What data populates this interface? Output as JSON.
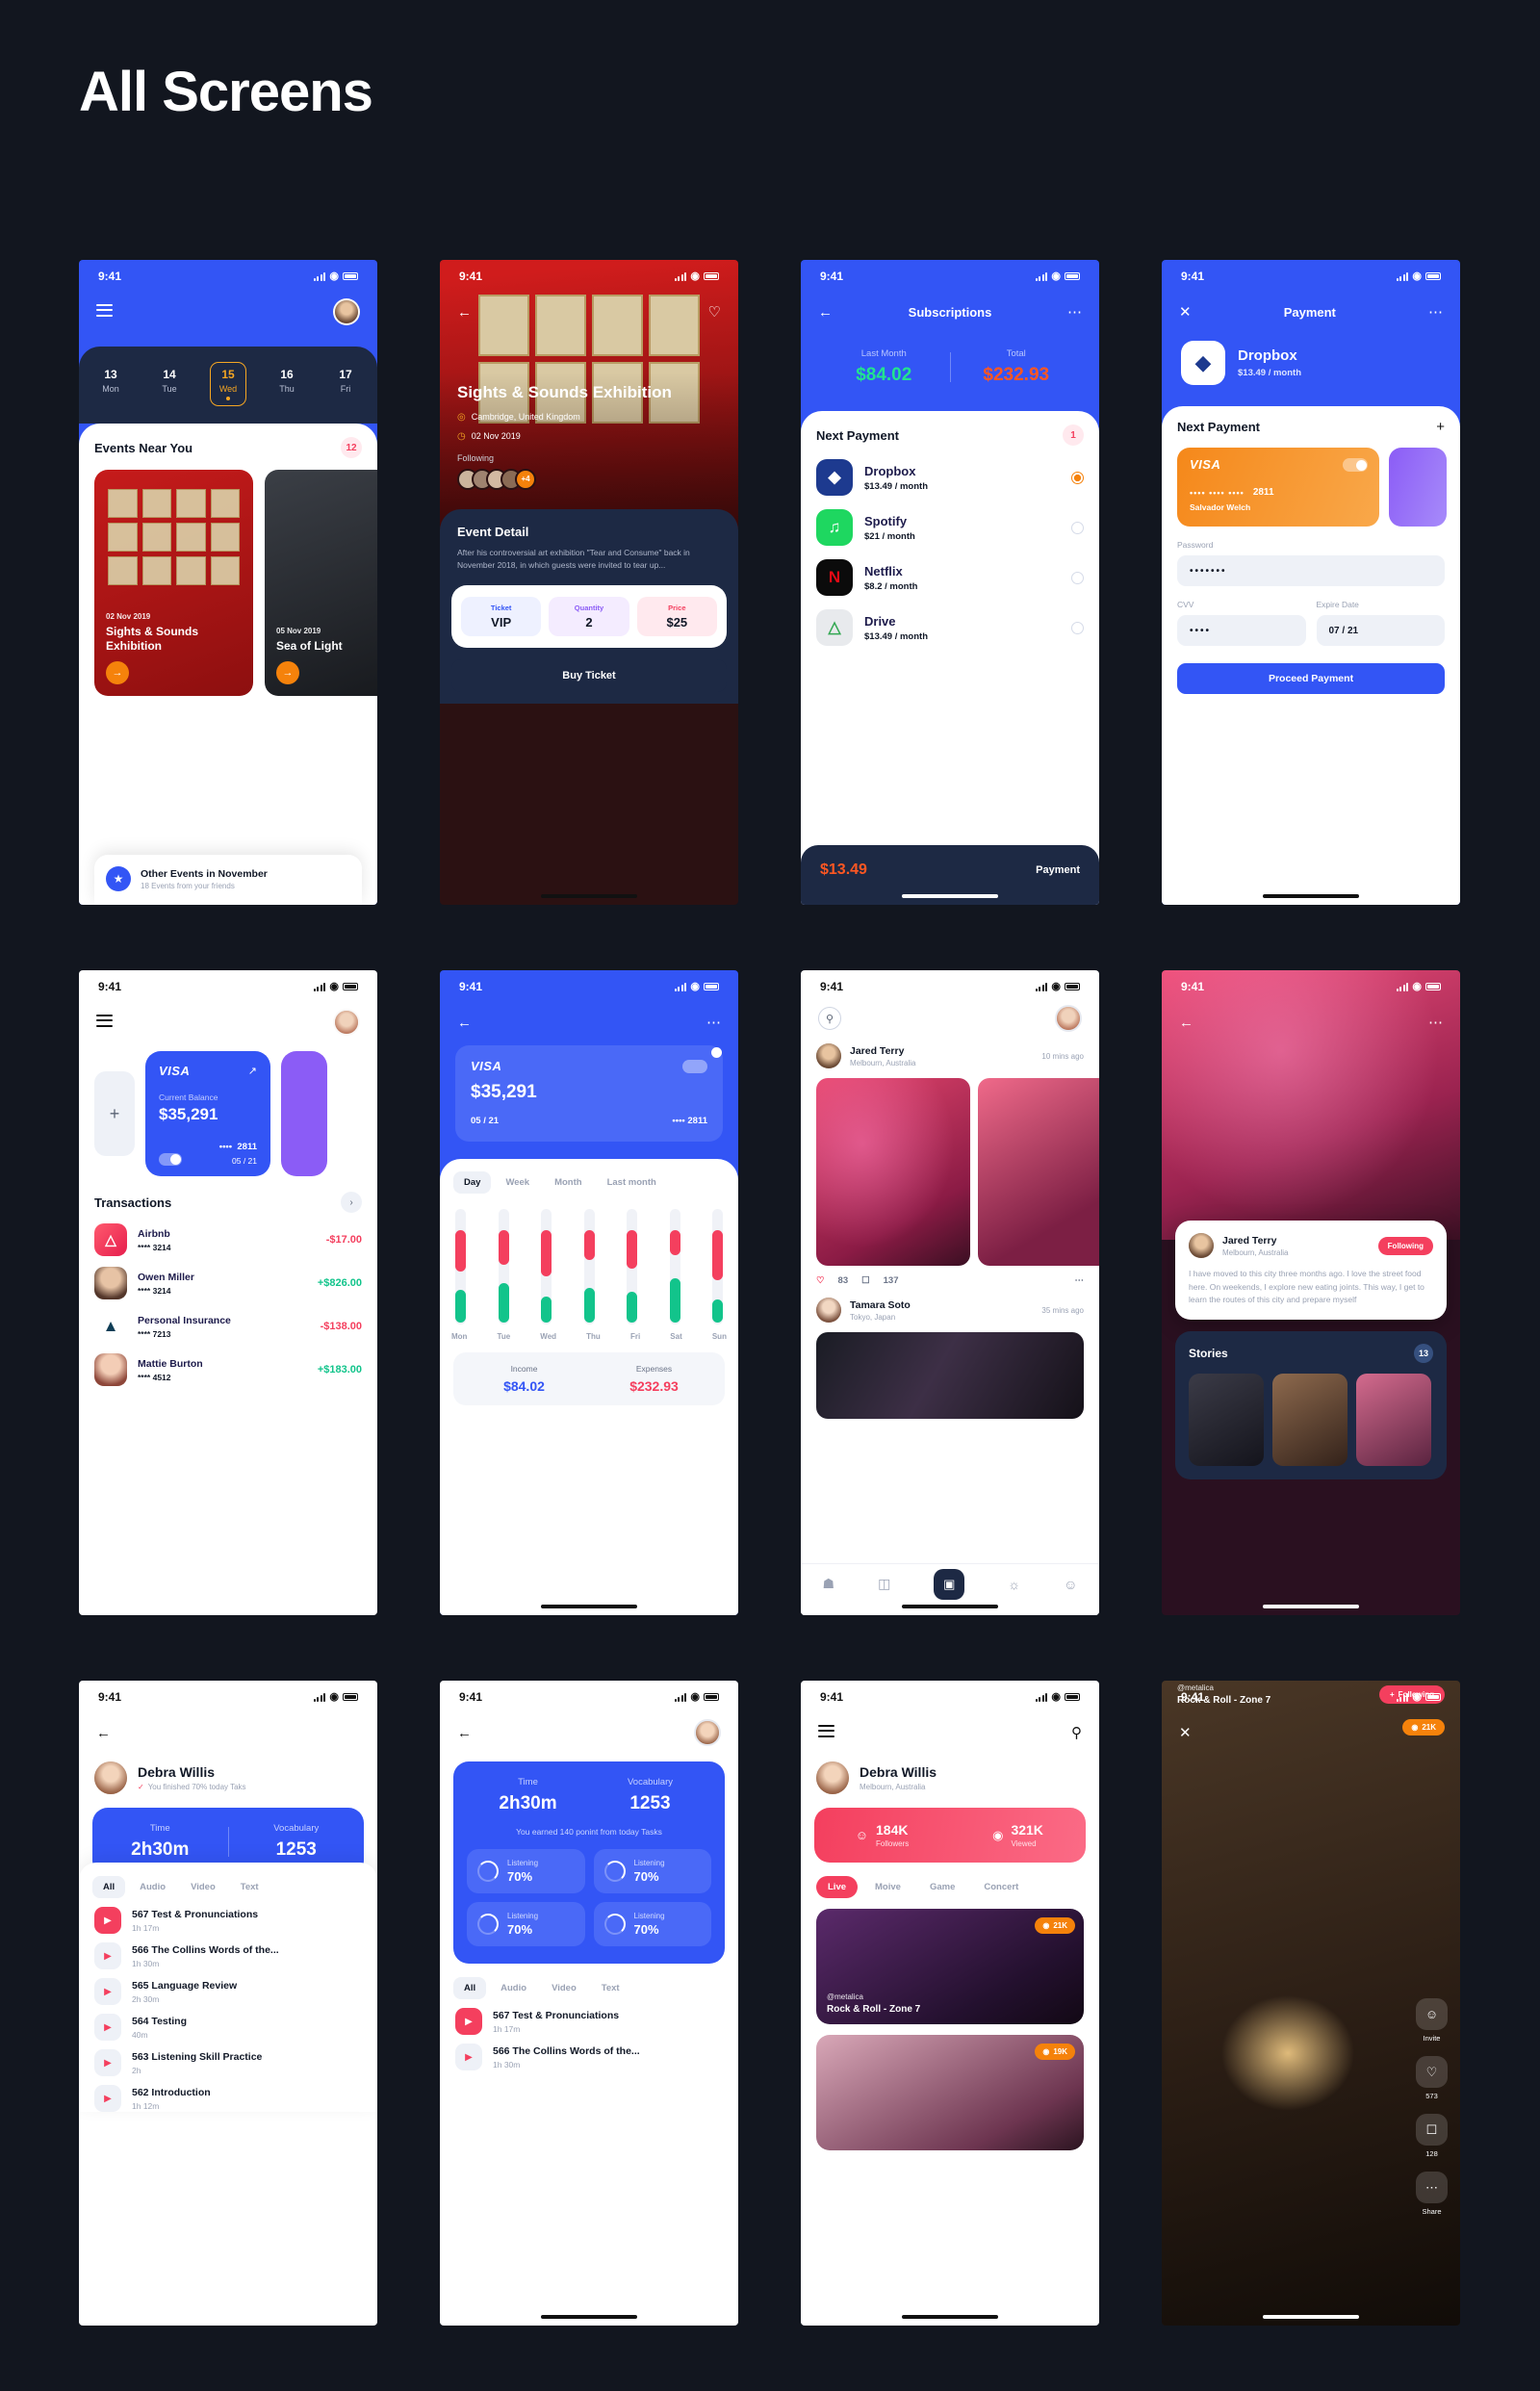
{
  "page": {
    "title": "All Screens"
  },
  "status_bar": {
    "time": "9:41"
  },
  "screens": {
    "events": {
      "calendar": [
        {
          "day": "13",
          "weekday": "Mon"
        },
        {
          "day": "14",
          "weekday": "Tue"
        },
        {
          "day": "15",
          "weekday": "Wed"
        },
        {
          "day": "16",
          "weekday": "Thu"
        },
        {
          "day": "17",
          "weekday": "Fri"
        }
      ],
      "section_title": "Events Near You",
      "badge": "12",
      "cards": [
        {
          "date": "02 Nov 2019",
          "name": "Sights & Sounds Exhibition"
        },
        {
          "date": "05 Nov 2019",
          "name": "Sea of Light"
        }
      ],
      "other": {
        "title": "Other Events in November",
        "subtitle": "18 Events from your friends"
      }
    },
    "event_detail": {
      "title": "Sights & Sounds Exhibition",
      "location": "Cambridge, United Kingdom",
      "date": "02 Nov 2019",
      "following_label": "Following",
      "followers_more": "+4",
      "panel_title": "Event Detail",
      "panel_text": "After his controversial art exhibition \"Tear and Consume\" back in November 2018, in which guests were invited to tear up...",
      "options": [
        {
          "label": "Ticket",
          "value": "VIP"
        },
        {
          "label": "Quantity",
          "value": "2"
        },
        {
          "label": "Price",
          "value": "$25"
        }
      ],
      "buy_button": "Buy Ticket"
    },
    "subscriptions": {
      "title": "Subscriptions",
      "stats": [
        {
          "label": "Last Month",
          "value": "$84.02"
        },
        {
          "label": "Total",
          "value": "$232.93"
        }
      ],
      "next_payment_label": "Next Payment",
      "badge": "1",
      "items": [
        {
          "name": "Dropbox",
          "price": "$13.49 / month",
          "selected": true
        },
        {
          "name": "Spotify",
          "price": "$21 / month",
          "selected": false
        },
        {
          "name": "Netflix",
          "price": "$8.2 / month",
          "selected": false
        },
        {
          "name": "Drive",
          "price": "$13.49 / month",
          "selected": false
        }
      ],
      "footer": {
        "amount": "$13.49",
        "action": "Payment"
      }
    },
    "payment": {
      "title": "Payment",
      "app_name": "Dropbox",
      "app_price": "$13.49 / month",
      "next_payment_label": "Next Payment",
      "card": {
        "brand": "VISA",
        "dots": "••••  ••••  ••••",
        "last4": "2811",
        "holder": "Salvador Welch"
      },
      "fields": {
        "password_label": "Password",
        "password_value": "•••••••",
        "cvv_label": "CVV",
        "cvv_value": "••••",
        "expire_label": "Expire Date",
        "expire_value": "07 / 21"
      },
      "submit": "Proceed Payment"
    },
    "wallet": {
      "card": {
        "brand": "VISA",
        "balance_label": "Current Balance",
        "balance": "$35,291",
        "last4": "2811",
        "expire": "05 / 21"
      },
      "transactions_title": "Transactions",
      "transactions": [
        {
          "name": "Airbnb",
          "card": "**** 3214",
          "amount": "-$17.00",
          "sign": "neg"
        },
        {
          "name": "Owen Miller",
          "card": "**** 3214",
          "amount": "+$826.00",
          "sign": "pos"
        },
        {
          "name": "Personal Insurance",
          "card": "**** 7213",
          "amount": "-$138.00",
          "sign": "neg"
        },
        {
          "name": "Mattie Burton",
          "card": "**** 4512",
          "amount": "+$183.00",
          "sign": "pos"
        }
      ]
    },
    "stats": {
      "card": {
        "brand": "VISA",
        "balance": "$35,291",
        "expire": "05 / 21",
        "dots": "••••",
        "last4": "2811"
      },
      "tabs": [
        "Day",
        "Week",
        "Month",
        "Last month"
      ],
      "active_tab": "Day",
      "summary": [
        {
          "label": "Income",
          "value": "$84.02"
        },
        {
          "label": "Expenses",
          "value": "$232.93"
        }
      ]
    },
    "feed": {
      "posts": [
        {
          "name": "Jared Terry",
          "location": "Melbourn, Australia",
          "time": "10 mins ago",
          "likes": "83",
          "comments": "137"
        },
        {
          "name": "Tamara Soto",
          "location": "Tokyo, Japan",
          "time": "35 mins ago"
        }
      ]
    },
    "profile_story": {
      "name": "Jared Terry",
      "location": "Melbourn, Australia",
      "follow_button": "Following",
      "bio": "I have moved to this city three months ago. I love the street food here. On weekends, I explore new eating joints. This way, I get to learn the routes of this city and prepare myself",
      "stories_title": "Stories",
      "stories_count": "13"
    },
    "profile_lessons": {
      "name": "Debra Willis",
      "subtitle": "You  finished 70% today Taks",
      "stats": [
        {
          "label": "Time",
          "value": "2h30m"
        },
        {
          "label": "Vocabulary",
          "value": "1253"
        }
      ],
      "tabs": [
        "All",
        "Audio",
        "Video",
        "Text"
      ],
      "active_tab": "All",
      "lessons": [
        {
          "name": "567 Test & Pronunciations",
          "duration": "1h 17m",
          "active": true
        },
        {
          "name": "566 The Collins Words of the...",
          "duration": "1h 30m",
          "active": false
        },
        {
          "name": "565 Language Review",
          "duration": "2h 30m",
          "active": false
        },
        {
          "name": "564 Testing",
          "duration": "40m",
          "active": false
        },
        {
          "name": "563 Listening Skill Practice",
          "duration": "2h",
          "active": false
        },
        {
          "name": "562 Introduction",
          "duration": "1h 12m",
          "active": false
        }
      ]
    },
    "vocabulary": {
      "stats": [
        {
          "label": "Time",
          "value": "2h30m"
        },
        {
          "label": "Vocabulary",
          "value": "1253"
        }
      ],
      "note": "You earned 140 ponint from today Tasks",
      "progress": [
        {
          "label": "Listening",
          "value": "70%"
        },
        {
          "label": "Listening",
          "value": "70%"
        },
        {
          "label": "Listening",
          "value": "70%"
        },
        {
          "label": "Listening",
          "value": "70%"
        }
      ],
      "tabs": [
        "All",
        "Audio",
        "Video",
        "Text"
      ],
      "active_tab": "All",
      "lessons": [
        {
          "name": "567 Test & Pronunciations",
          "duration": "1h 17m",
          "active": true
        },
        {
          "name": "566 The Collins Words of the...",
          "duration": "1h 30m",
          "active": false
        }
      ]
    },
    "live": {
      "name": "Debra Willis",
      "location": "Melbourn, Australia",
      "stats": [
        {
          "value": "184K",
          "label": "Followers"
        },
        {
          "value": "321K",
          "label": "Viewed"
        }
      ],
      "tabs": [
        "Live",
        "Moive",
        "Game",
        "Concert"
      ],
      "active_tab": "Live",
      "cards": [
        {
          "views": "21K",
          "user": "@metalica",
          "title": "Rock & Roll - Zone 7"
        },
        {
          "views": "19K",
          "user": "",
          "title": ""
        }
      ]
    },
    "live_stream": {
      "views": "21K",
      "rail": [
        {
          "icon": "invite-icon",
          "label": "Invite"
        },
        {
          "icon": "heart-icon",
          "label": "573"
        },
        {
          "icon": "comment-icon",
          "label": "128"
        },
        {
          "icon": "more-icon",
          "label": "Share"
        }
      ],
      "user": "@metalica",
      "title": "Rock & Roll - Zone 7",
      "follow_button": "Following"
    }
  },
  "chart_data": {
    "type": "bar",
    "title": "Day",
    "categories": [
      "Mon",
      "Tue",
      "Wed",
      "Thu",
      "Fri",
      "Sat",
      "Sun"
    ],
    "series": [
      {
        "name": "Income",
        "color": "#12c48b",
        "values": [
          28,
          34,
          22,
          30,
          26,
          38,
          20
        ]
      },
      {
        "name": "Expenses",
        "color": "#f43f5e",
        "values": [
          36,
          30,
          40,
          26,
          34,
          22,
          44
        ]
      }
    ],
    "xlabel": "",
    "ylabel": "",
    "grid": false,
    "legend": "none"
  }
}
